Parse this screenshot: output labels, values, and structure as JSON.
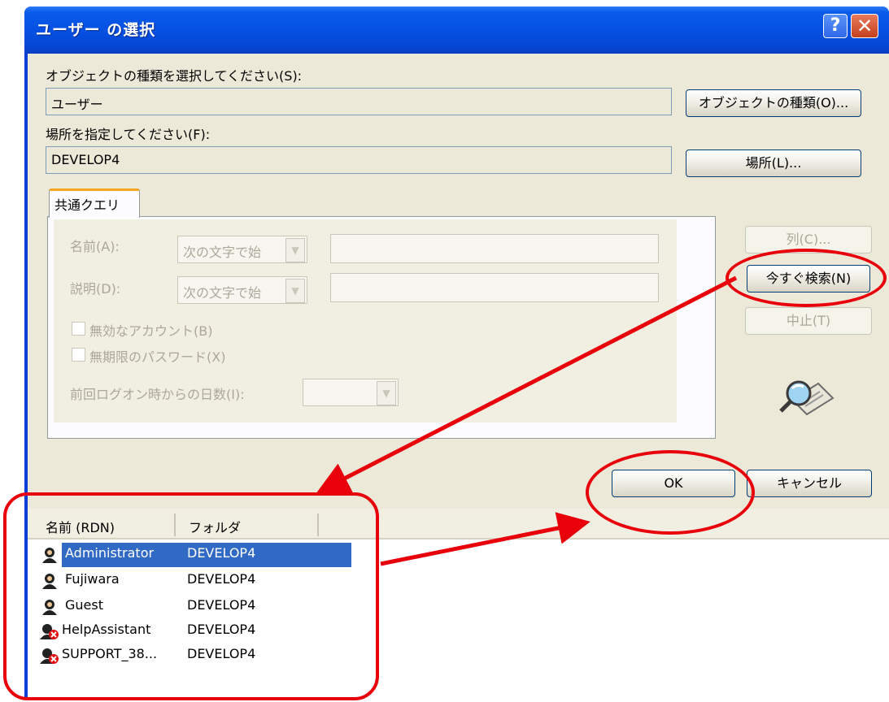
{
  "window": {
    "title": "ユーザー の選択",
    "help_glyph": "?",
    "close_glyph": "✕"
  },
  "object_type": {
    "label": "オブジェクトの種類を選択してください(S):",
    "value": "ユーザー",
    "button": "オブジェクトの種類(O)..."
  },
  "location": {
    "label": "場所を指定してください(F):",
    "value": "DEVELOP4",
    "button": "場所(L)..."
  },
  "tab": {
    "label": "共通クエリ"
  },
  "query": {
    "name_label": "名前(A):",
    "name_mode": "次の文字で始",
    "desc_label": "説明(D):",
    "desc_mode": "次の文字で始",
    "disabled_accounts": "無効なアカウント(B)",
    "non_expiring_password": "無期限のパスワード(X)",
    "days_since_logon_label": "前回ログオン時からの日数(I):"
  },
  "side_buttons": {
    "columns": "列(C)...",
    "find_now": "今すぐ検索(N)",
    "stop": "中止(T)"
  },
  "ok": "OK",
  "cancel": "キャンセル",
  "results": {
    "headers": [
      "名前 (RDN)",
      "フォルダ"
    ],
    "rows": [
      {
        "name": "Administrator",
        "folder": "DEVELOP4",
        "icon": "user-icon"
      },
      {
        "name": "Fujiwara",
        "folder": "DEVELOP4",
        "icon": "user-icon"
      },
      {
        "name": "Guest",
        "folder": "DEVELOP4",
        "icon": "user-icon"
      },
      {
        "name": "HelpAssistant",
        "folder": "DEVELOP4",
        "icon": "disabled-user-icon"
      },
      {
        "name": "SUPPORT_38...",
        "folder": "DEVELOP4",
        "icon": "disabled-user-icon"
      }
    ]
  },
  "colors": {
    "title_bar": "#0651e3",
    "dialog_bg": "#ece9d8",
    "selection": "#316ac5",
    "annotation": "#e8000b"
  }
}
